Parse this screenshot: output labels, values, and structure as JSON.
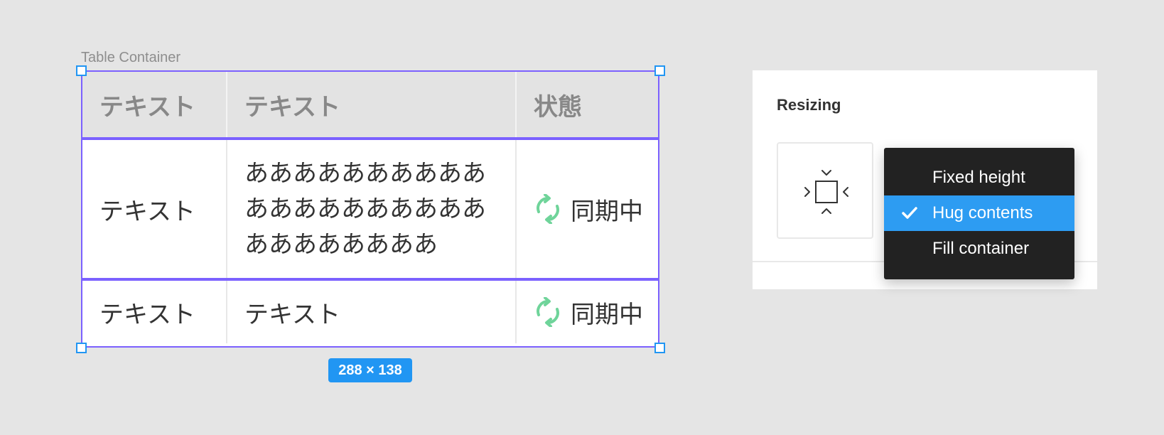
{
  "frame": {
    "label": "Table Container",
    "size_badge": "288 × 138"
  },
  "table": {
    "headers": [
      "テキスト",
      "テキスト",
      "状態"
    ],
    "rows": [
      {
        "col1": "テキスト",
        "col2": "ああああああああああ\nああああああああああ\nああああああああ",
        "status": "同期中",
        "status_icon": "sync-icon"
      },
      {
        "col1": "テキスト",
        "col2": "テキスト",
        "status": "同期中",
        "status_icon": "sync-icon"
      }
    ]
  },
  "panel": {
    "title": "Resizing",
    "resize_icon": "hug-contents-icon"
  },
  "dropdown": {
    "options": [
      "Fixed height",
      "Hug contents",
      "Fill container"
    ],
    "selected": "Hug contents"
  },
  "colors": {
    "selection": "#7b61ff",
    "accent_blue": "#2196f3",
    "sync_green": "#6fd49a",
    "menu_bg": "#222222",
    "menu_selected": "#2d9cf2"
  }
}
